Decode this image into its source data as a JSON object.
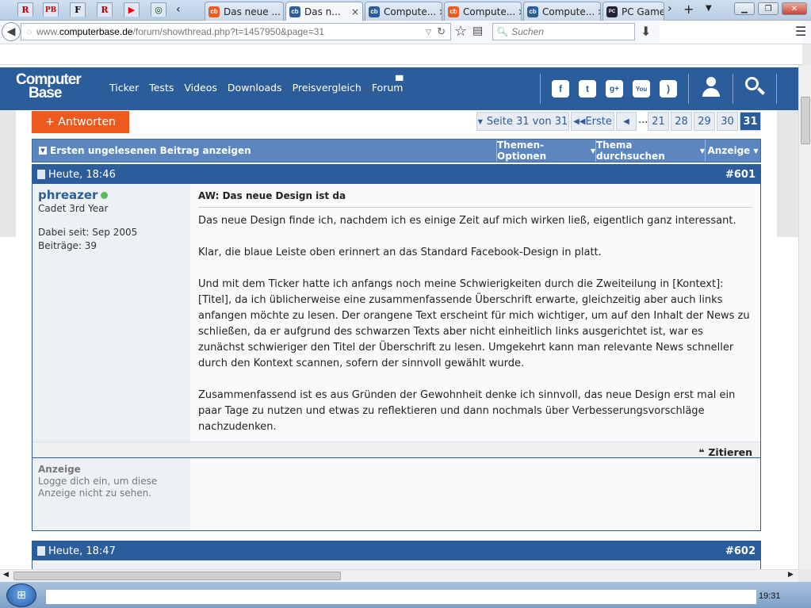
{
  "browser": {
    "pinned_tabs": [
      {
        "icon": "R",
        "name": "pinned-tab-r1",
        "color": "#b00"
      },
      {
        "icon": "PB",
        "name": "pinned-tab-pb",
        "color": "#c00"
      },
      {
        "icon": "F",
        "name": "pinned-tab-faz",
        "color": "#000"
      },
      {
        "icon": "R",
        "name": "pinned-tab-r2",
        "color": "#b00"
      },
      {
        "icon": "▶",
        "name": "pinned-tab-youtube",
        "color": "#e00"
      },
      {
        "icon": "◎",
        "name": "pinned-tab-circuit",
        "color": "#040"
      }
    ],
    "tabs": [
      {
        "title": "Das neue ...",
        "active": false
      },
      {
        "title": "Das n...",
        "active": true
      },
      {
        "title": "Compute...",
        "active": false
      },
      {
        "title": "Compute...",
        "active": false
      },
      {
        "title": "Compute...",
        "active": false
      },
      {
        "title": "PC Game",
        "active": false
      }
    ],
    "url_domain": "www.computerbase.de",
    "url_path": "/forum/showthread.php?t=1457950&page=31",
    "url_prefix": "www.",
    "search_placeholder": "Suchen"
  },
  "site": {
    "logo_line1": "Computer",
    "logo_line2": "Base",
    "nav": [
      "Ticker",
      "Tests",
      "Videos",
      "Downloads",
      "Preisvergleich",
      "Forum"
    ],
    "reply_button": "+ Antworten",
    "pagination": {
      "page_label": "Seite 31 von 31",
      "first": "Erste",
      "dots": "...",
      "pages": [
        "21",
        "28",
        "29",
        "30",
        "31"
      ],
      "current": "31"
    },
    "toolbar": {
      "unread": "Ersten ungelesenen Beitrag anzeigen",
      "options": "Themen-Optionen",
      "search": "Thema durchsuchen",
      "display": "Anzeige"
    },
    "post1": {
      "date": "Heute, 18:46",
      "number": "#601",
      "username": "phreazer",
      "rank": "Cadet 3rd Year",
      "joined": "Dabei seit: Sep 2005",
      "posts": "Beiträge: 39",
      "title": "AW: Das neue Design ist da",
      "paragraphs": [
        "Das neue Design finde ich, nachdem ich es einige Zeit auf mich wirken ließ, eigentlich ganz interessant.",
        "Klar, die blaue Leiste oben erinnert an das Standard Facebook-Design in platt.",
        "Und mit dem Ticker hatte ich anfangs noch meine Schwierigkeiten durch die Zweiteilung in [Kontext]:[Titel], da ich üblicherweise eine zusammenfassende Überschrift erwarte, gleichzeitig aber auch links anfangen möchte zu lesen. Der orangene Text erscheint für mich wichtiger, um auf den Inhalt der News zu schließen, da er aufgrund des schwarzen Texts aber nicht einheitlich links ausgerichtet ist, war es zunächst schwieriger den Titel der Überschrift zu lesen. Umgekehrt kann man relevante News schneller durch den Kontext scannen, sofern der sinnvoll gewählt wurde.",
        "Zusammenfassend ist es aus Gründen der Gewohnheit denke ich sinnvoll, das neue Design erst mal ein paar Tage zu nutzen und etwas zu reflektieren und dann nochmals über Verbesserungsvorschläge nachzudenken."
      ],
      "quote": "Zitieren"
    },
    "ad": {
      "title": "Anzeige",
      "text": "Logge dich ein, um diese Anzeige nicht zu sehen."
    },
    "post2": {
      "date": "Heute, 18:47",
      "number": "#602"
    }
  },
  "taskbar": {
    "clock": "19:31"
  },
  "colors": {
    "brand_blue": "#2b5d9b",
    "accent_orange": "#ec5a1f",
    "toolbar_blue": "#5b86c0"
  }
}
